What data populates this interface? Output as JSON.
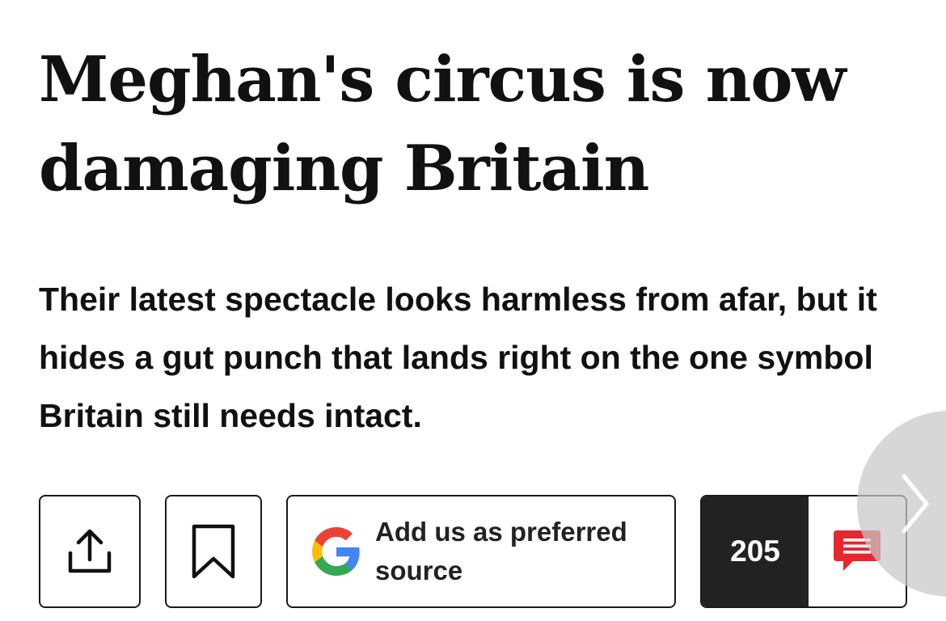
{
  "article": {
    "headline": "Meghan's circus is now damaging Britain",
    "standfirst": "Their latest spectacle looks harmless from afar, but it hides a gut punch that lands right on the one symbol Britain still needs intact."
  },
  "actions": {
    "share_icon": "share-icon",
    "bookmark_icon": "bookmark-icon",
    "preferred_source_icon": "google-icon",
    "preferred_source_label": "Add us as preferred source",
    "comment_count": "205",
    "comment_icon": "comment-bubble-icon"
  },
  "navigation": {
    "next_icon": "chevron-right-icon"
  },
  "colors": {
    "text": "#111111",
    "comment_count_bg": "#222222",
    "comment_icon": "#e8262d",
    "next_button_bg": "#c8c8c8"
  }
}
